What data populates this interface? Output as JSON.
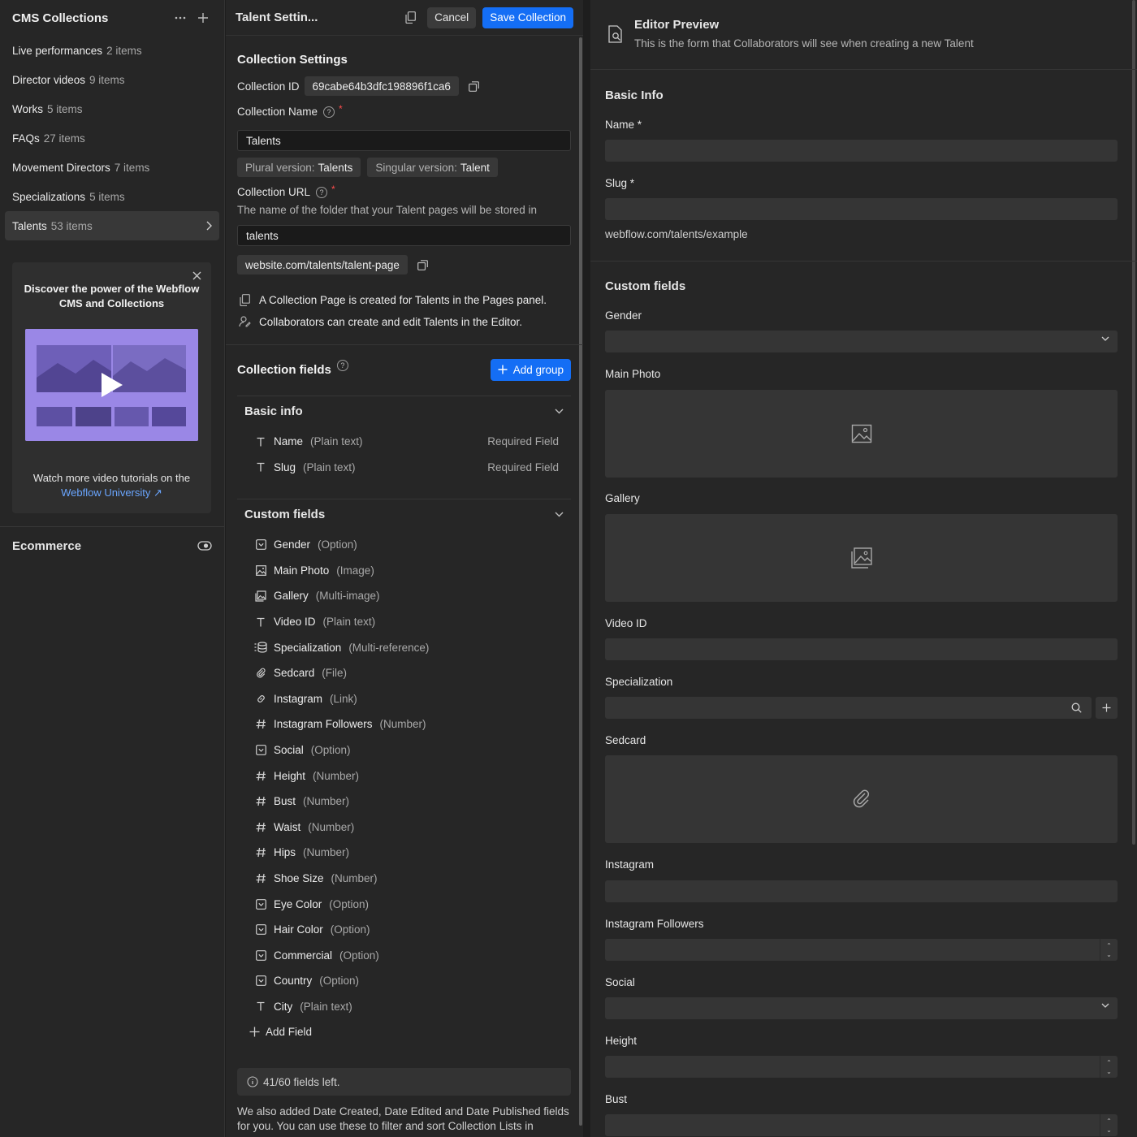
{
  "sidebar": {
    "title": "CMS Collections",
    "collections": [
      {
        "name": "Live performances",
        "count": "2 items"
      },
      {
        "name": "Director videos",
        "count": "9 items"
      },
      {
        "name": "Works",
        "count": "5 items"
      },
      {
        "name": "FAQs",
        "count": "27 items"
      },
      {
        "name": "Movement Directors",
        "count": "7 items"
      },
      {
        "name": "Specializations",
        "count": "5 items"
      },
      {
        "name": "Talents",
        "count": "53 items"
      }
    ],
    "promo": {
      "title": "Discover the power of the Webflow CMS and Collections",
      "footer_text": "Watch more video tutorials on the",
      "footer_link": "Webflow University ↗"
    },
    "ecommerce_label": "Ecommerce"
  },
  "settings": {
    "header_title": "Talent Settin...",
    "cancel_label": "Cancel",
    "save_label": "Save Collection",
    "section_title": "Collection Settings",
    "collection_id_label": "Collection ID",
    "collection_id_value": "69cabe64b3dfc198896f1ca6",
    "collection_name_label": "Collection Name",
    "collection_name_value": "Talents",
    "plural_label": "Plural version:",
    "plural_value": "Talents",
    "singular_label": "Singular version:",
    "singular_value": "Talent",
    "url_label": "Collection URL",
    "url_help": "The name of the folder that your Talent pages will be stored in",
    "url_value": "talents",
    "url_preview": "website.com/talents/talent-page",
    "info_page": "A Collection Page is created for Talents in the Pages panel.",
    "info_collab": "Collaborators can create and edit Talents in the Editor.",
    "fields_title": "Collection fields",
    "add_group_label": "Add group",
    "basic_group": {
      "title": "Basic info",
      "fields": [
        {
          "icon": "T",
          "name": "Name",
          "type": "(Plain text)",
          "required": "Required Field"
        },
        {
          "icon": "T",
          "name": "Slug",
          "type": "(Plain text)",
          "required": "Required Field"
        }
      ]
    },
    "custom_group": {
      "title": "Custom fields",
      "fields": [
        {
          "icon": "option",
          "name": "Gender",
          "type": "(Option)"
        },
        {
          "icon": "image",
          "name": "Main Photo",
          "type": "(Image)"
        },
        {
          "icon": "multi-image",
          "name": "Gallery",
          "type": "(Multi-image)"
        },
        {
          "icon": "T",
          "name": "Video ID",
          "type": "(Plain text)"
        },
        {
          "icon": "multi-reference",
          "name": "Specialization",
          "type": "(Multi-reference)"
        },
        {
          "icon": "file",
          "name": "Sedcard",
          "type": "(File)"
        },
        {
          "icon": "link",
          "name": "Instagram",
          "type": "(Link)"
        },
        {
          "icon": "#",
          "name": "Instagram Followers",
          "type": "(Number)"
        },
        {
          "icon": "option",
          "name": "Social",
          "type": "(Option)"
        },
        {
          "icon": "#",
          "name": "Height",
          "type": "(Number)"
        },
        {
          "icon": "#",
          "name": "Bust",
          "type": "(Number)"
        },
        {
          "icon": "#",
          "name": "Waist",
          "type": "(Number)"
        },
        {
          "icon": "#",
          "name": "Hips",
          "type": "(Number)"
        },
        {
          "icon": "#",
          "name": "Shoe Size",
          "type": "(Number)"
        },
        {
          "icon": "option",
          "name": "Eye Color",
          "type": "(Option)"
        },
        {
          "icon": "option",
          "name": "Hair Color",
          "type": "(Option)"
        },
        {
          "icon": "option",
          "name": "Commercial",
          "type": "(Option)"
        },
        {
          "icon": "option",
          "name": "Country",
          "type": "(Option)"
        },
        {
          "icon": "T",
          "name": "City",
          "type": "(Plain text)"
        }
      ]
    },
    "add_field_label": "Add Field",
    "fields_left": "41/60 fields left.",
    "footer_note": "We also added Date Created, Date Edited and Date Published fields for you. You can use these to filter and sort Collection Lists in"
  },
  "preview": {
    "title": "Editor Preview",
    "subtitle": "This is the form that Collaborators will see when creating a new Talent",
    "basic_title": "Basic Info",
    "name_label": "Name *",
    "slug_label": "Slug *",
    "slug_note": "webflow.com/talents/example",
    "custom_title": "Custom fields",
    "labels": {
      "gender": "Gender",
      "main_photo": "Main Photo",
      "gallery": "Gallery",
      "video_id": "Video ID",
      "specialization": "Specialization",
      "sedcard": "Sedcard",
      "instagram": "Instagram",
      "instagram_followers": "Instagram Followers",
      "social": "Social",
      "height": "Height",
      "bust": "Bust"
    }
  },
  "colors": {
    "accent": "#146ef5",
    "link": "#6aa6ff",
    "required": "#ff4d4d",
    "promo_video": "#9a87e6"
  }
}
